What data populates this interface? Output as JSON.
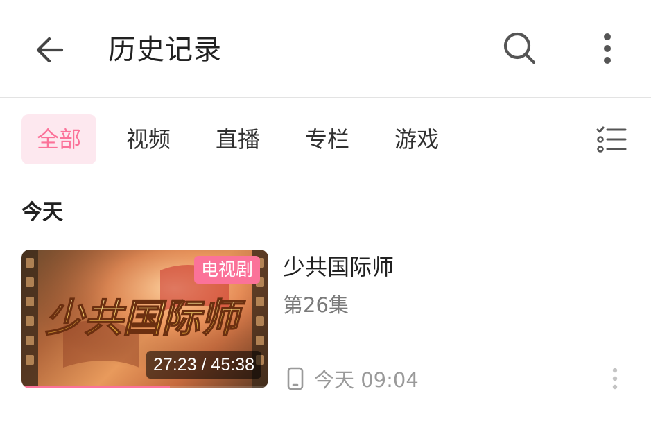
{
  "header": {
    "title": "历史记录",
    "back_icon": "arrow-left-icon",
    "search_icon": "search-icon",
    "more_icon": "more-vertical-icon"
  },
  "tabs": [
    {
      "label": "全部",
      "active": true
    },
    {
      "label": "视频",
      "active": false
    },
    {
      "label": "直播",
      "active": false
    },
    {
      "label": "专栏",
      "active": false
    },
    {
      "label": "游戏",
      "active": false
    }
  ],
  "filter_icon": "list-filter-icon",
  "sections": [
    {
      "title": "今天",
      "items": [
        {
          "title": "少共国际师",
          "subtitle": "第26集",
          "tag": "电视剧",
          "thumb_title": "少共国际师",
          "time": "27:23 / 45:38",
          "progress": 0.6,
          "device_icon": "phone-icon",
          "viewed_at": "今天 09:04"
        }
      ]
    }
  ],
  "colors": {
    "accent": "#fb7299",
    "accent_bg": "#fde8ef"
  }
}
